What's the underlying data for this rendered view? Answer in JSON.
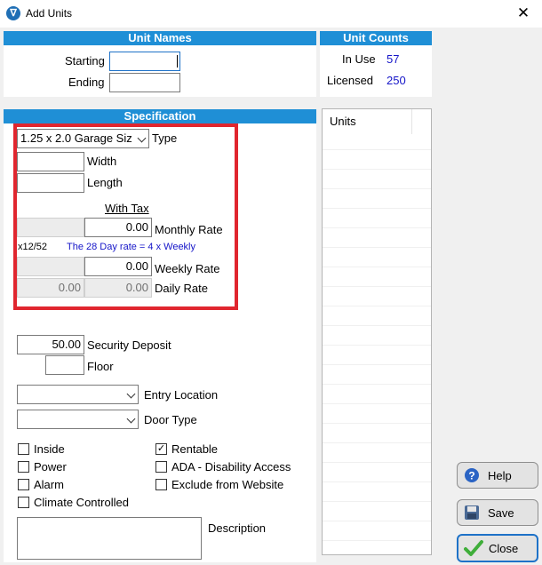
{
  "window": {
    "title": "Add Units"
  },
  "unit_names": {
    "header": "Unit Names",
    "starting_label": "Starting",
    "starting_value": "",
    "ending_label": "Ending",
    "ending_value": ""
  },
  "unit_counts": {
    "header": "Unit Counts",
    "in_use_label": "In Use",
    "in_use_value": "57",
    "licensed_label": "Licensed",
    "licensed_value": "250"
  },
  "specification": {
    "header": "Specification",
    "type_value": "1.25 x 2.0 Garage Siz",
    "type_label": "Type",
    "width_label": "Width",
    "width_value": "",
    "length_label": "Length",
    "length_value": "",
    "with_tax_label": "With Tax",
    "monthly_value": "0.00",
    "monthly_label": "Monthly Rate",
    "x1252_label": "x12/52",
    "day_rate_note": "The 28 Day rate = 4 x Weekly",
    "weekly_value": "0.00",
    "weekly_label": "Weekly Rate",
    "daily_base_value": "0.00",
    "daily_value": "0.00",
    "daily_label": "Daily Rate",
    "security_value": "50.00",
    "security_label": "Security Deposit",
    "floor_label": "Floor",
    "floor_value": "",
    "entry_location_label": "Entry Location",
    "entry_location_value": "",
    "door_type_label": "Door Type",
    "door_type_value": "",
    "description_label": "Description",
    "description_value": ""
  },
  "checkboxes": {
    "inside": {
      "label": "Inside",
      "checked": false
    },
    "power": {
      "label": "Power",
      "checked": false
    },
    "alarm": {
      "label": "Alarm",
      "checked": false
    },
    "climate": {
      "label": "Climate Controlled",
      "checked": false
    },
    "rentable": {
      "label": "Rentable",
      "checked": true,
      "mark": "✓"
    },
    "ada": {
      "label": "ADA - Disability Access",
      "checked": false
    },
    "exclude": {
      "label": "Exclude from Website",
      "checked": false
    }
  },
  "units_list": {
    "header": "Units"
  },
  "buttons": {
    "help": "Help",
    "save": "Save",
    "close": "Close"
  },
  "colors": {
    "header_blue": "#1f8fd6",
    "highlight_red": "#e0262f",
    "value_blue": "#1515c8"
  },
  "icons": {
    "app": "app-logo-icon",
    "help": "help-icon",
    "save": "floppy-save-icon",
    "close": "checkmark-icon"
  }
}
